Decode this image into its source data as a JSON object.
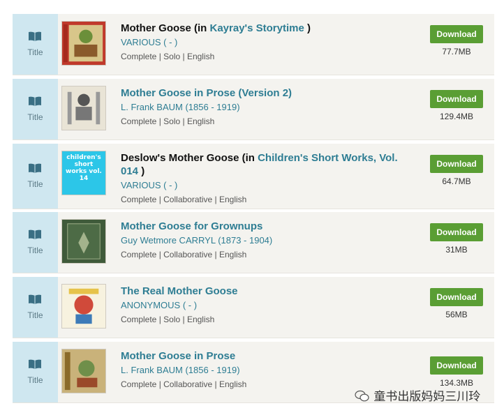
{
  "type_label": "Title",
  "download_label": "Download",
  "items": [
    {
      "title": "Mother Goose",
      "title_prefix": "Mother Goose (in ",
      "parent": "Kayray's Storytime",
      "title_suffix": " )",
      "author": "VARIOUS ( - )",
      "meta": "Complete | Solo | English",
      "size": "77.7MB"
    },
    {
      "title": "Mother Goose in Prose (Version 2)",
      "author": "L. Frank BAUM (1856 - 1919)",
      "meta": "Complete | Solo | English",
      "size": "129.4MB"
    },
    {
      "title_prefix": "Deslow's Mother Goose (in ",
      "parent": "Children's Short Works, Vol. 014",
      "title_suffix": " )",
      "author": "VARIOUS ( - )",
      "meta": "Complete | Collaborative | English",
      "size": "64.7MB",
      "cover_text": "children's short works vol. 14"
    },
    {
      "title": "Mother Goose for Grownups",
      "author": "Guy Wetmore CARRYL (1873 - 1904)",
      "meta": "Complete | Collaborative | English",
      "size": "31MB"
    },
    {
      "title": "The Real Mother Goose",
      "author": "ANONYMOUS ( - )",
      "meta": "Complete | Solo | English",
      "size": "56MB"
    },
    {
      "title": "Mother Goose in Prose",
      "author": "L. Frank BAUM (1856 - 1919)",
      "meta": "Complete | Collaborative | English",
      "size": "134.3MB"
    }
  ],
  "watermark": "童书出版妈妈三川玲"
}
